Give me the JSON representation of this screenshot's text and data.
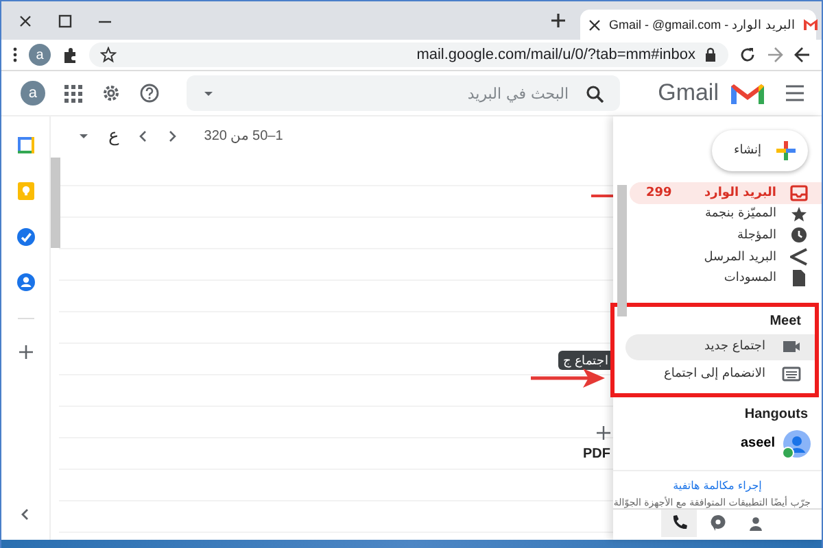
{
  "browser": {
    "tab_title": "البريد الوارد - Gmail - @gmail.com",
    "url": "mail.google.com/mail/u/0/?tab=mm#inbox",
    "profile_initial": "a"
  },
  "header": {
    "logo_text": "Gmail",
    "search_placeholder": "البحث في البريد",
    "account_initial": "a"
  },
  "side_apps": [
    {
      "kind": "calendar"
    },
    {
      "kind": "keep"
    },
    {
      "kind": "tasks"
    },
    {
      "kind": "contacts"
    }
  ],
  "toolbar": {
    "input_tool": "ع",
    "pagination": "1–50 من 320"
  },
  "mail_list": {
    "fragment": "PDF",
    "tooltip": "اجتماع ج"
  },
  "compose": "إنشاء",
  "folders": [
    {
      "kind": "inbox",
      "label": "البريد الوارد",
      "count": "299",
      "selected": true
    },
    {
      "kind": "star",
      "label": "المميّزة بنجمة",
      "selected": false
    },
    {
      "kind": "clock",
      "label": "المؤجلة",
      "selected": false
    },
    {
      "kind": "send",
      "label": "البريد المرسل",
      "selected": false
    },
    {
      "kind": "draft",
      "label": "المسودات",
      "selected": false
    }
  ],
  "meet": {
    "title": "Meet",
    "items": [
      {
        "kind": "video",
        "label": "اجتماع جديد",
        "selected": true
      },
      {
        "kind": "keyboard",
        "label": "الانضمام إلى اجتماع",
        "selected": false
      }
    ]
  },
  "hangouts": {
    "title": "Hangouts",
    "contacts": [
      {
        "name": "aseel",
        "online": true
      }
    ],
    "call_link": "إجراء مكالمة هاتفية",
    "hint": "جرّب أيضًا التطبيقات المتوافقة مع الأجهزة الجوّالة",
    "tabs": [
      {
        "kind": "phone",
        "selected": true
      },
      {
        "kind": "chat",
        "selected": false
      },
      {
        "kind": "people",
        "selected": false
      }
    ]
  }
}
